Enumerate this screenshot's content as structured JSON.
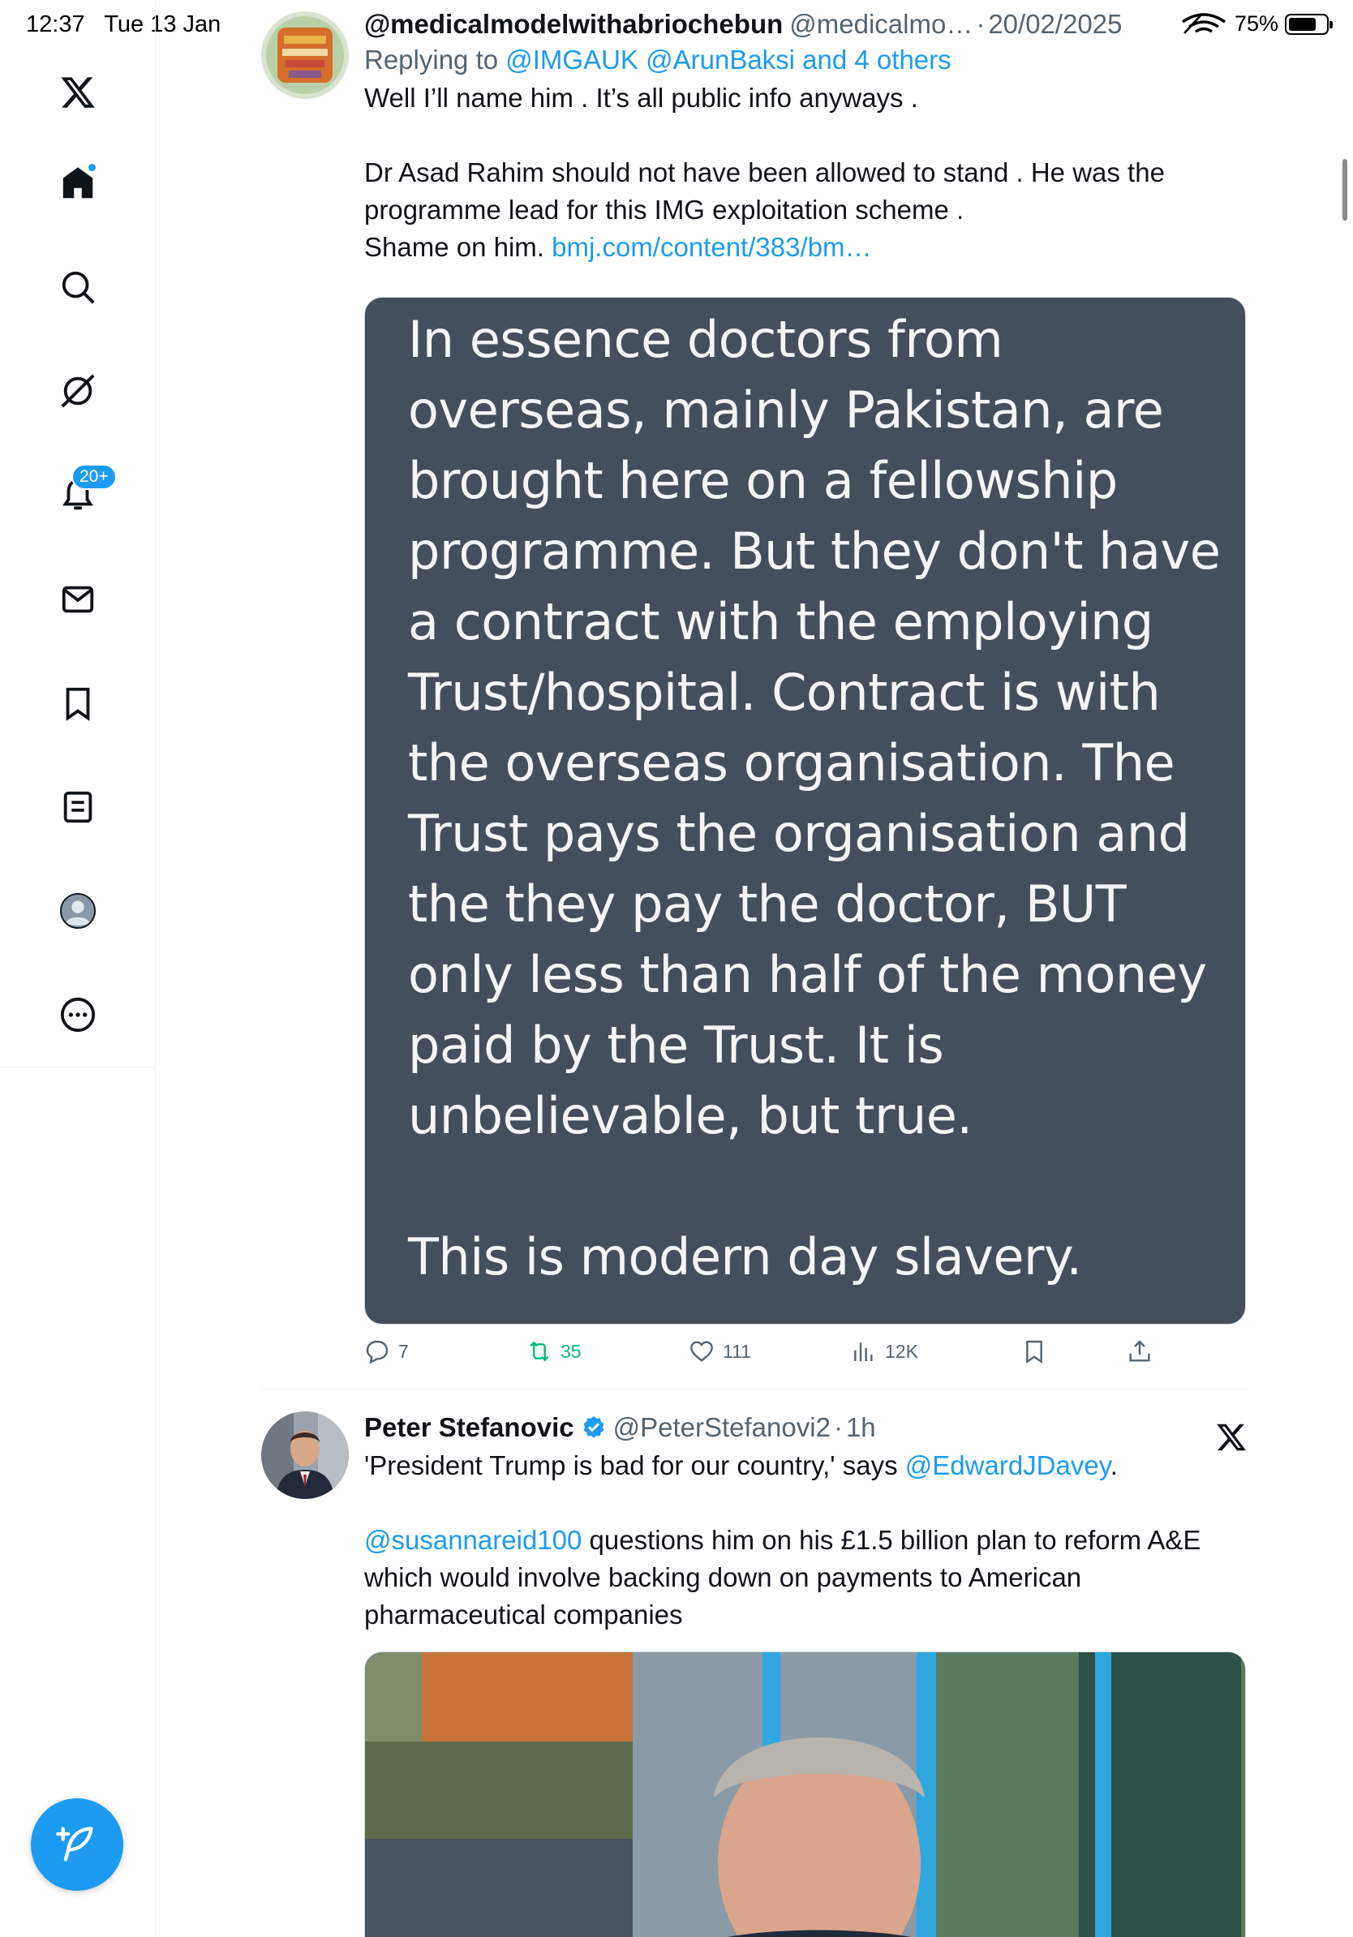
{
  "status_bar": {
    "time": "12:37",
    "date": "Tue 13 Jan",
    "battery": "75%",
    "battery_level": 0.75
  },
  "sidebar": {
    "notifications_badge": "20+",
    "items": [
      {
        "icon": "x-logo-icon"
      },
      {
        "icon": "home-icon"
      },
      {
        "icon": "search-icon"
      },
      {
        "icon": "grok-icon"
      },
      {
        "icon": "notifications-bell-icon"
      },
      {
        "icon": "messages-envelope-icon"
      },
      {
        "icon": "bookmark-icon"
      },
      {
        "icon": "lists-icon"
      },
      {
        "icon": "profile-avatar-icon"
      },
      {
        "icon": "more-circle-icon"
      }
    ],
    "compose_icon": "compose-feather-icon"
  },
  "tweet1": {
    "name": "@medicalmodelwithabriochebun",
    "handle": "@medicalmo…",
    "sep": "·",
    "date": "20/02/2025",
    "replying_prefix": "Replying to ",
    "replying_links": "@IMGAUK @ArunBaksi and 4 others",
    "text": "Well I’ll name him . It’s all public info anyways .\n\nDr Asad Rahim should not have been allowed to stand . He was the programme lead for this IMG exploitation scheme .\nShame on him. ",
    "link": "bmj.com/content/383/bm…",
    "image_text": "In essence doctors from\noverseas, mainly Pakistan, are\nbrought here on a fellowship\nprogramme. But they don't have\na contract with the employing\nTrust/hospital. Contract is with\nthe overseas organisation. The\nTrust pays the organisation and\nthe they pay the doctor, BUT\nonly less than half of the money\npaid by the Trust. It is\nunbelievable, but true.\n\nThis is modern day slavery.",
    "replies": "7",
    "reposts": "35",
    "likes": "111",
    "views": "12K"
  },
  "tweet2": {
    "name": "Peter Stefanovic",
    "handle": "@PeterStefanovi2",
    "sep": "·",
    "date": "1h",
    "text_before": "'President Trump is bad for our country,' says ",
    "mention1": "@EdwardJDavey",
    "text_after1": ".",
    "mention2": "@susannareid100",
    "text_after2": " questions him on his £1.5 billion plan to reform A&E which would involve backing down on payments to American pharmaceutical companies"
  },
  "colors": {
    "accent": "#1d9bf0",
    "repost": "#00ba7c",
    "secondary_text": "#536471",
    "image_bg": "#454f5b"
  }
}
